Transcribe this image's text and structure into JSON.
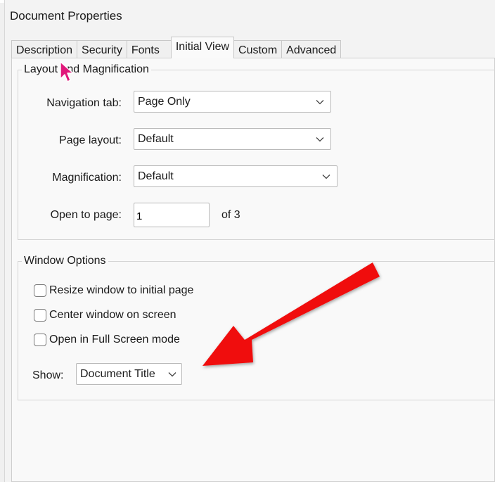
{
  "dialog": {
    "title": "Document Properties"
  },
  "tabs": [
    {
      "label": "Description",
      "active": false
    },
    {
      "label": "Security",
      "active": false
    },
    {
      "label": "Fonts",
      "active": false
    },
    {
      "label": "Initial View",
      "active": true
    },
    {
      "label": "Custom",
      "active": false
    },
    {
      "label": "Advanced",
      "active": false
    }
  ],
  "layout_group": {
    "legend": "Layout and Magnification",
    "navigation_tab": {
      "label": "Navigation tab:",
      "value": "Page Only"
    },
    "page_layout": {
      "label": "Page layout:",
      "value": "Default"
    },
    "magnification": {
      "label": "Magnification:",
      "value": "Default"
    },
    "open_to_page": {
      "label": "Open to page:",
      "value": "1",
      "total": "of 3"
    }
  },
  "window_group": {
    "legend": "Window Options",
    "options": [
      {
        "label": "Resize window to initial page",
        "checked": false
      },
      {
        "label": "Center window on screen",
        "checked": false
      },
      {
        "label": "Open in Full Screen mode",
        "checked": false
      }
    ],
    "show": {
      "label": "Show:",
      "value": "Document Title"
    }
  },
  "colors": {
    "annotation_arrow": "#f01010",
    "cursor": "#e0187a",
    "panel_bg": "#f9f9f9",
    "control_border": "#b9b9b9"
  },
  "icons": [
    "chevron-down-icon",
    "checkbox-icon",
    "red-arrow-annotation",
    "mouse-cursor-icon"
  ]
}
